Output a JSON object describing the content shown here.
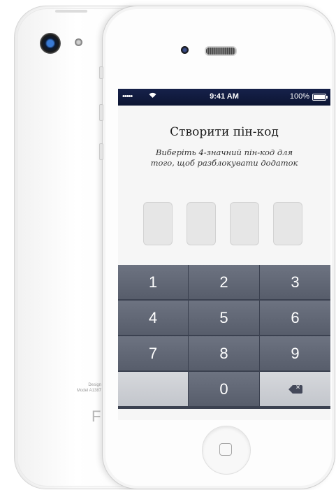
{
  "status_bar": {
    "signal": "•••••",
    "wifi_icon": "wifi-icon",
    "time": "9:41 AM",
    "battery_percent": "100%"
  },
  "pin_screen": {
    "title": "Створити пін-код",
    "subtitle": "Виберіть 4-значний пін-код для того, щоб разблокувати додаток",
    "pin_slots": 4
  },
  "keypad": {
    "keys": [
      "1",
      "2",
      "3",
      "4",
      "5",
      "6",
      "7",
      "8",
      "9",
      "",
      "0",
      "backspace"
    ]
  },
  "back_phone": {
    "model_line_1": "Design",
    "model_line_2": "Model A1387",
    "logo_fragment": "F"
  },
  "colors": {
    "status_bar": "#16214a",
    "key_dark": "#5f6573",
    "key_light": "#cfd1d6",
    "pin_box": "#e6e6e6"
  }
}
